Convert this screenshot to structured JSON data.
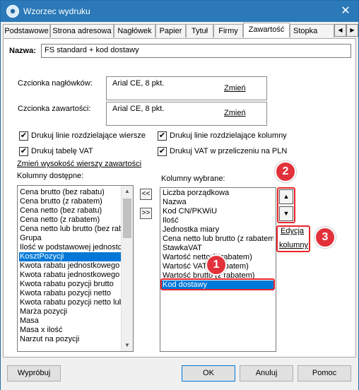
{
  "window": {
    "title": "Wzorzec wydruku"
  },
  "tabs": [
    "Podstawowe",
    "Strona adresowa",
    "Nagłówek",
    "Papier",
    "Tytuł",
    "Firmy",
    "Zawartość",
    "Stopka"
  ],
  "active_tab": "Zawartość",
  "name": {
    "label": "Nazwa:",
    "value": "FS standard + kod dostawy"
  },
  "fonts": {
    "header_label": "Czcionka nagłówków:",
    "header_value": "Arial CE, 8 pkt.",
    "content_label": "Czcionka zawartości:",
    "content_value": "Arial CE, 8 pkt.",
    "change_label": "Zmień"
  },
  "checkboxes": [
    {
      "label": "Drukuj linie rozdzielające wiersze",
      "checked": true
    },
    {
      "label": "Drukuj linie rozdzielające kolumny",
      "checked": true
    },
    {
      "label": "Drukuj tabelę VAT",
      "checked": true
    },
    {
      "label": "Drukuj VAT w przeliczeniu na PLN",
      "checked": true
    }
  ],
  "row_height_link": "Zmień wysokość wierszy zawartości",
  "available": {
    "label": "Kolumny dostępne:",
    "items": [
      "Cena brutto (bez rabatu)",
      "Cena brutto (z rabatem)",
      "Cena netto (bez rabatu)",
      "Cena netto (z rabatem)",
      "Cena netto lub brutto (bez rabatu)",
      "Grupa",
      "Ilość w podstawowej jednostce",
      "KosztPozycji",
      "Kwota rabatu jednostkowego",
      "Kwota rabatu jednostkowego",
      "Kwota rabatu pozycji brutto",
      "Kwota rabatu pozycji netto",
      "Kwota rabatu pozycji netto lub",
      "Marża pozycji",
      "Masa",
      "Masa x ilość",
      "Narzut na pozycji"
    ],
    "selected": "KosztPozycji"
  },
  "move_buttons": {
    "left": "<<",
    "right": ">>"
  },
  "chosen": {
    "label": "Kolumny wybrane:",
    "items": [
      "Liczba porządkowa",
      "Nazwa",
      "Kod CN/PKWiU",
      "Ilość",
      "Jednostka miary",
      "Cena netto lub brutto (z rabatem)",
      "StawkaVAT",
      "Wartość netto (z rabatem)",
      "Wartość VAT (z rabatem)",
      "Wartość brutto (z rabatem)",
      "Kod dostawy"
    ],
    "selected": "Kod dostawy"
  },
  "edit_columns": {
    "line1": "Edycja",
    "line2": "kolumny"
  },
  "markers": [
    "1",
    "2",
    "3"
  ],
  "buttons": {
    "preview": "Wypróbuj",
    "ok": "OK",
    "cancel": "Anuluj",
    "help": "Pomoc"
  },
  "icons": {
    "close": "close-icon",
    "tab_left": "arrow-left-icon",
    "tab_right": "arrow-right-icon",
    "up": "arrow-up-icon",
    "down": "arrow-down-icon"
  },
  "colors": {
    "titlebar": "#2b79b8",
    "selection": "#0078d7",
    "annotation": "#e2313a"
  }
}
